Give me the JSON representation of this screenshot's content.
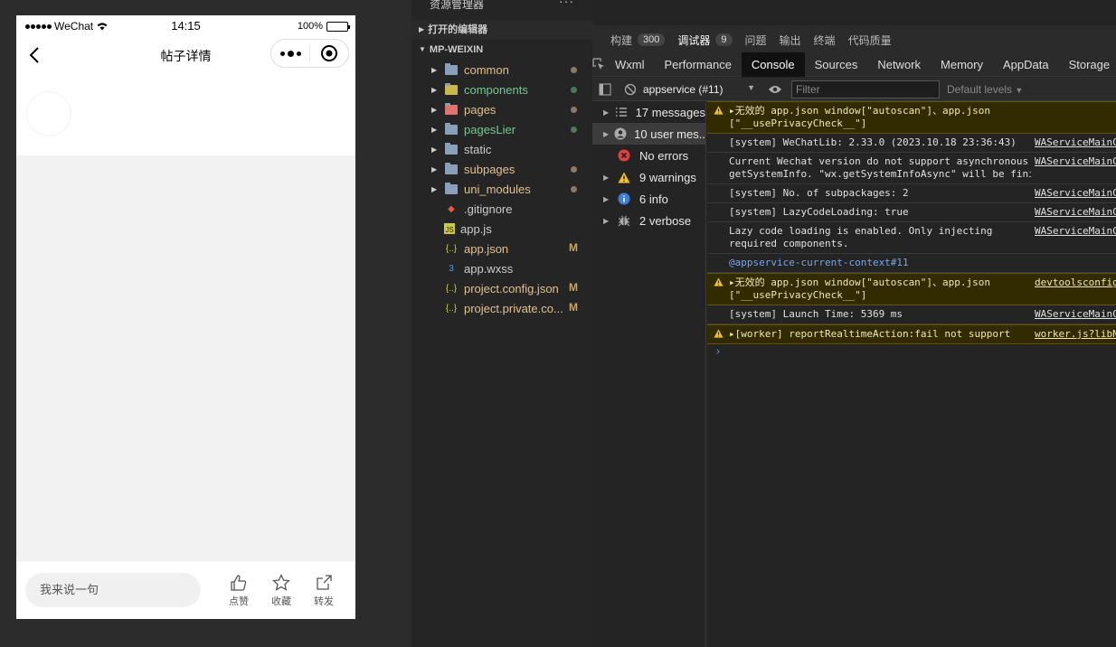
{
  "phone": {
    "carrier": "WeChat",
    "time": "14:15",
    "battery": "100%",
    "battery_level": 1.0,
    "title": "帖子详情",
    "comment_placeholder": "我来说一句",
    "actions": {
      "like": "点赞",
      "favorite": "收藏",
      "share": "转发"
    }
  },
  "explorer": {
    "title": "资源管理器",
    "open_editors": "打开的编辑器",
    "project": "MP-WEIXIN",
    "items": [
      {
        "name": "common",
        "type": "folder",
        "color": "#e2c08d",
        "status_color": "#8d7b5f"
      },
      {
        "name": "components",
        "type": "folder",
        "color": "#73c991",
        "status_color": "#4a7a5a"
      },
      {
        "name": "pages",
        "type": "folder",
        "color": "#e2c08d",
        "status_color": "#8d7b5f"
      },
      {
        "name": "pagesLier",
        "type": "folder",
        "color": "#73c991",
        "status_color": "#4a7a5a"
      },
      {
        "name": "static",
        "type": "folder",
        "color": "#cccccc"
      },
      {
        "name": "subpages",
        "type": "folder",
        "color": "#e2c08d",
        "status_color": "#8d7b5f"
      },
      {
        "name": "uni_modules",
        "type": "folder",
        "color": "#e2c08d",
        "status_color": "#8d7b5f"
      },
      {
        "name": ".gitignore",
        "type": "file",
        "color": "#cccccc"
      },
      {
        "name": "app.js",
        "type": "file",
        "color": "#cccccc"
      },
      {
        "name": "app.json",
        "type": "file",
        "color": "#e2c08d",
        "badge": "M"
      },
      {
        "name": "app.wxss",
        "type": "file",
        "color": "#cccccc"
      },
      {
        "name": "project.config.json",
        "type": "file",
        "color": "#e2c08d",
        "badge": "M"
      },
      {
        "name": "project.private.co...",
        "type": "file",
        "color": "#e2c08d",
        "badge": "M"
      }
    ]
  },
  "devtools": {
    "top_tabs": [
      {
        "label": "构建",
        "count": "300"
      },
      {
        "label": "调试器",
        "count": "9",
        "active": true
      },
      {
        "label": "问题"
      },
      {
        "label": "输出"
      },
      {
        "label": "终端"
      },
      {
        "label": "代码质量"
      }
    ],
    "panel_tabs": [
      "Wxml",
      "Performance",
      "Console",
      "Sources",
      "Network",
      "Memory",
      "AppData",
      "Storage"
    ],
    "active_panel": "Console",
    "context": "appservice (#11)",
    "filter_placeholder": "Filter",
    "levels": "Default levels",
    "sidebar": [
      {
        "label": "17 messages",
        "icon": "list"
      },
      {
        "label": "10 user mes...",
        "icon": "user"
      },
      {
        "label": "No errors",
        "icon": "error"
      },
      {
        "label": "9 warnings",
        "icon": "warning"
      },
      {
        "label": "6 info",
        "icon": "info"
      },
      {
        "label": "2 verbose",
        "icon": "verbose"
      }
    ],
    "messages": [
      {
        "type": "warn",
        "text": "▸无效的 app.json window[\"autoscan\"]、app.json\n[\"__usePrivacyCheck__\"]",
        "source": ""
      },
      {
        "type": "log",
        "text": "[system] WeChatLib: 2.33.0 (2023.10.18 23:36:43)",
        "source": "WAServiceMainContext.js"
      },
      {
        "type": "log",
        "text": "Current Wechat version do not support asynchronous\ngetSystemInfo. \"wx.getSystemInfoAsync\" will be finished by synchronous",
        "source": "WAServiceMainContext.js"
      },
      {
        "type": "log",
        "text": "[system] No. of subpackages: 2",
        "source": "WAServiceMainContext.js"
      },
      {
        "type": "log",
        "text": "[system] LazyCodeLoading: true",
        "source": "WAServiceMainContext.js"
      },
      {
        "type": "log",
        "text": "Lazy code loading is enabled. Only injecting\nrequired components.",
        "source": "WAServiceMainContext.js"
      },
      {
        "type": "link",
        "text": "@appservice-current-context#11",
        "source": ""
      },
      {
        "type": "warn",
        "text": "▸无效的 app.json window[\"autoscan\"]、app.json\n[\"__usePrivacyCheck__\"]",
        "source": "devtoolsconfig.json"
      },
      {
        "type": "log",
        "text": "[system] Launch Time: 5369 ms",
        "source": "WAServiceMainContext.js"
      },
      {
        "type": "warn",
        "text": "▸[worker] reportRealtimeAction:fail not support",
        "source": "worker.js?libName"
      }
    ],
    "prompt": "›"
  }
}
